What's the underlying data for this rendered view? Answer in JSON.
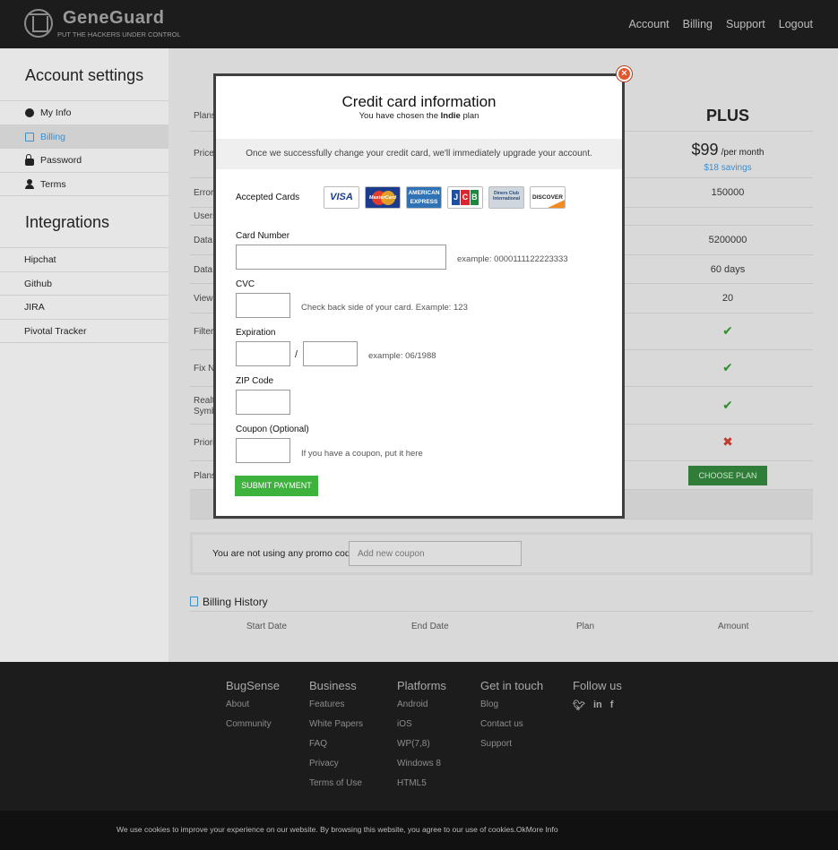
{
  "header": {
    "brand": "GeneGuard",
    "tagline": "PUT THE HACKERS UNDER CONTROL",
    "nav": [
      "Account",
      "Billing",
      "Support",
      "Logout"
    ]
  },
  "sidebar": {
    "account_title": "Account settings",
    "account_items": [
      {
        "label": "My Info",
        "icon": "info-icon"
      },
      {
        "label": "Billing",
        "icon": "billing-icon",
        "active": true
      },
      {
        "label": "Password",
        "icon": "lock-icon"
      },
      {
        "label": "Terms",
        "icon": "user-icon"
      }
    ],
    "integrations_title": "Integrations",
    "integration_items": [
      "Hipchat",
      "Github",
      "JIRA",
      "Pivotal Tracker"
    ]
  },
  "plans": {
    "plan_name": "PLUS",
    "row_labels": [
      "Plans",
      "Price",
      "Error",
      "Users",
      "Data",
      "Data",
      "View",
      "Filter",
      "Fix N",
      "Realt Symb",
      "Priori",
      "Plans"
    ],
    "price": "$99",
    "price_period": "/per month",
    "savings": "$18 savings",
    "values": [
      "150000",
      "5200000",
      "60 days",
      "20"
    ],
    "choose_label": "CHOOSE PLAN"
  },
  "promo": {
    "text": "You are not using any promo code.",
    "placeholder": "Add new coupon"
  },
  "billing_history": {
    "title": "Billing History",
    "columns": [
      "Start Date",
      "End Date",
      "Plan",
      "Amount"
    ]
  },
  "modal": {
    "title": "Credit card information",
    "subtitle_pre": "You have chosen the",
    "subtitle_plan": "Indie",
    "subtitle_post": "plan",
    "banner": "Once we successfully change your credit card, we'll immediately upgrade your account.",
    "accepted_cards_label": "Accepted Cards",
    "cards": {
      "visa": "VISA",
      "mastercard": "MasterCard",
      "amex": "AMERICAN EXPRESS",
      "jcb": [
        "J",
        "C",
        "B"
      ],
      "diners": "Diners Club International",
      "discover": "DISCOVER"
    },
    "card_number_label": "Card Number",
    "card_number_hint": "example: 0000111122223333",
    "cvc_label": "CVC",
    "cvc_hint": "Check back side of your card. Example: 123",
    "expiration_label": "Expiration",
    "expiration_sep": "/",
    "expiration_hint": "example: 06/1988",
    "zip_label": "ZIP Code",
    "coupon_label": "Coupon (Optional)",
    "coupon_hint": "If you have a coupon, put it here",
    "submit_label": "SUBMIT PAYMENT",
    "close_glyph": "×"
  },
  "footer": {
    "columns": [
      {
        "title": "BugSense",
        "links": [
          "About",
          "Community"
        ]
      },
      {
        "title": "Business",
        "links": [
          "Features",
          "White Papers",
          "FAQ",
          "Privacy",
          "Terms of Use"
        ]
      },
      {
        "title": "Platforms",
        "links": [
          "Android",
          "iOS",
          "WP(7,8)",
          "Windows 8",
          "HTML5"
        ]
      },
      {
        "title": "Get in touch",
        "links": [
          "Blog",
          "Contact us",
          "Support"
        ]
      },
      {
        "title": "Follow us",
        "links": []
      }
    ],
    "social": [
      "twitter-icon",
      "linkedin-icon",
      "facebook-icon"
    ]
  },
  "cookie": {
    "text": "We use cookies to improve your experience on our website. By browsing this website, you agree to our use of cookies.OkMore Info"
  },
  "colors": {
    "accent_blue": "#3a8fcf",
    "submit_green": "#3db23d",
    "close_red": "#e4572e",
    "header_bg": "#1c1c1c"
  }
}
